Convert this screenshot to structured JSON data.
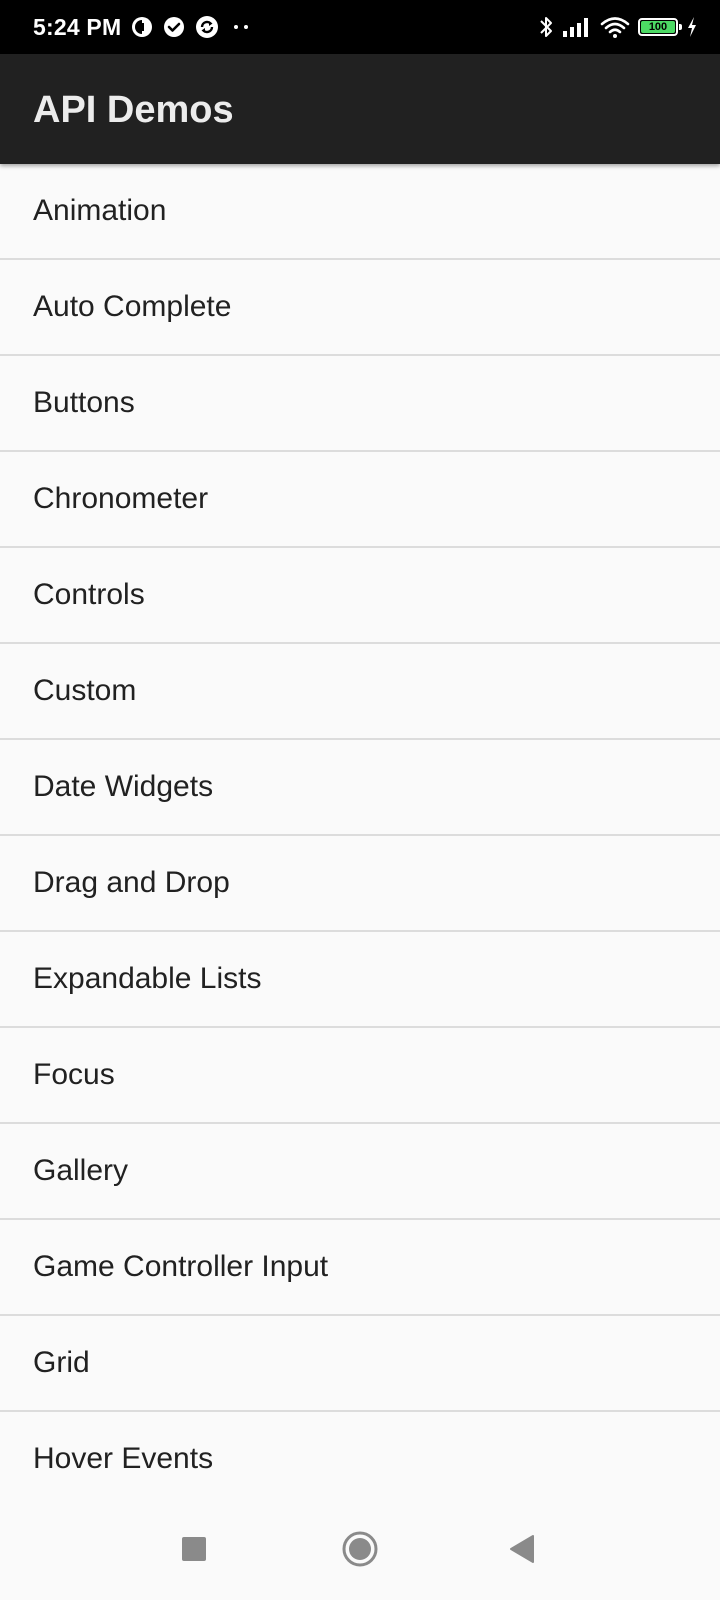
{
  "status_bar": {
    "time": "5:24 PM",
    "battery_level": "100",
    "notification_icons": [
      "data-saver-icon",
      "check-circle-icon",
      "sync-icon",
      "more-dots-icon"
    ],
    "system_icons": [
      "bluetooth-icon",
      "signal-icon",
      "wifi-icon",
      "battery-icon",
      "charging-icon"
    ]
  },
  "app_bar": {
    "title": "API Demos"
  },
  "list": {
    "items": [
      {
        "label": "Animation"
      },
      {
        "label": "Auto Complete"
      },
      {
        "label": "Buttons"
      },
      {
        "label": "Chronometer"
      },
      {
        "label": "Controls"
      },
      {
        "label": "Custom"
      },
      {
        "label": "Date Widgets"
      },
      {
        "label": "Drag and Drop"
      },
      {
        "label": "Expandable Lists"
      },
      {
        "label": "Focus"
      },
      {
        "label": "Gallery"
      },
      {
        "label": "Game Controller Input"
      },
      {
        "label": "Grid"
      },
      {
        "label": "Hover Events"
      }
    ]
  },
  "nav_bar": {
    "buttons": [
      "recent-apps-icon",
      "home-icon",
      "back-icon"
    ]
  },
  "colors": {
    "status_bar": "#000000",
    "app_bar": "#212121",
    "list_background": "#fafafa",
    "divider": "#dcdcdc",
    "text": "#212121",
    "battery": "#4cd964"
  }
}
